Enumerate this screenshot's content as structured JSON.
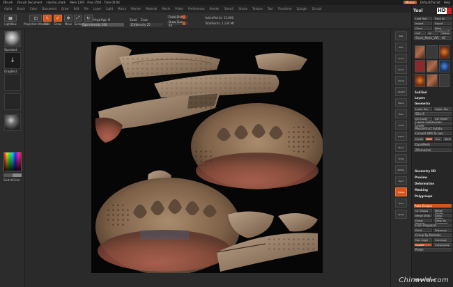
{
  "titlebar": {
    "app_label": "ZBrush",
    "doc_label": "Zbrush Document",
    "tool_label": "colorful_shark",
    "stats": "Mem 1265 · Free 2560 · Time 00:00",
    "menus_btn": "Menus",
    "script_btn": "DefaultZScript",
    "help": "Help"
  },
  "menubar": [
    "Alpha",
    "Brush",
    "Color",
    "Document",
    "Draw",
    "Edit",
    "File",
    "Layer",
    "Light",
    "Macro",
    "Marker",
    "Material",
    "Movie",
    "Picker",
    "Preferences",
    "Render",
    "Stencil",
    "Stroke",
    "Texture",
    "Tool",
    "Transform",
    "Zplugin",
    "Zscript"
  ],
  "toolbar": {
    "lightbox": "LightBox",
    "projection": "Projection Master",
    "edit": "Edit",
    "draw": "Draw",
    "move": "Move",
    "scale": "Scale",
    "rotate": "Rotate",
    "mrgb": "Mrgb",
    "rgb": "Rgb",
    "m": "M",
    "zadd": "Zadd",
    "zsub": "Zsub",
    "rgb_intensity": "Rgb Intensity 100",
    "z_intensity": "Z Intensity 25",
    "focal_shift": "Focal Shift 0",
    "draw_size": "Draw Size 64",
    "active_points": "ActivePoints: 15,680",
    "total_points": "TotalPoints: 1.134 Mil"
  },
  "left_shelf": {
    "brush": "Standard",
    "stroke": "DragRect",
    "alpha": "Alpha Off",
    "texture": "Texture Off",
    "material": "MatCap Gray",
    "gradient_label": "Gradient",
    "switch_color": "SwitchColor"
  },
  "right_shelf": [
    "BPR",
    "SPix",
    "Scroll",
    "Zoom",
    "Actual",
    "AAHalf",
    "Persp",
    "Floor",
    "Local",
    "Frame",
    "Move",
    "Scale",
    "Rotate",
    "PolyF",
    "Transp",
    "Solo",
    "Xpose"
  ],
  "tray": {
    "title": "Tool",
    "hd_text": "HD",
    "buttons": [
      "Load Tool",
      "Save As",
      "Import",
      "Export",
      "Clone",
      "Make PolyMesh3D",
      "GoZ",
      "All",
      "Visible",
      "R",
      "Lightbox ▸ Tools"
    ],
    "current_tool": "Shark_Mesh_V05 . 48",
    "sections": [
      "SubTool",
      "Layers",
      "Geometry",
      "Geometry HD",
      "Preview",
      "Deformation",
      "Masking",
      "Polygroups",
      "Contact",
      "Morph Target",
      "Polypaint",
      "UV Map",
      "Texture Map",
      "Displacement Map",
      "Normal Map",
      "Vector Displacement Map",
      "Display Properties",
      "Unified Skin",
      "Initialize",
      "Import",
      "Export"
    ],
    "geometry_rows": [
      "Lower Res",
      "Higher Res",
      "SDiv 6",
      "Del Lower",
      "Del Higher",
      "Freeze SubDivision Levels",
      "Reconstruct Subdiv",
      "Convert BPR To Geo",
      "Divide",
      "Smt",
      "Suv",
      "ReUV"
    ],
    "dynamesh": "DynaMesh",
    "zremesher": "ZRemesher",
    "polygroups_rows": [
      "Auto Groups",
      "Uv Groups",
      "Merge Similar",
      "Merge Stray",
      "Group Visible",
      "Group Masked",
      "Group As Dynamesh Sub",
      "From Polypaint",
      "Polish",
      "Tolerance",
      "Group By Normals",
      "Max Angle",
      "Coverage",
      "Cluster",
      "GroupsLoop",
      "Polish"
    ],
    "footer": "Morph Target"
  },
  "colors": {
    "accent": "#d8541c",
    "panel": "#2c2c2c",
    "canvas_bg": "#060606"
  },
  "watermark": "Chinavid.com"
}
